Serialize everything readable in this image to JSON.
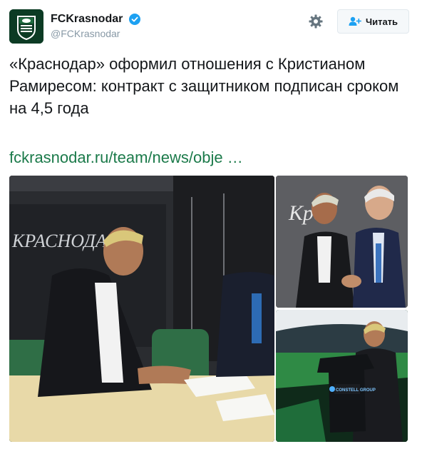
{
  "account": {
    "display_name": "FCKrasnodar",
    "handle": "@FCKrasnodar",
    "verified": true,
    "avatar_icon": "fc-krasnodar-crest-icon"
  },
  "actions": {
    "settings_icon": "gear-icon",
    "follow_label": "Читать",
    "follow_icon": "add-user-icon"
  },
  "tweet": {
    "text": "«Краснодар» оформил отношения с Кристианом Рамиресом: контракт с защитником подписан сроком на 4,5 года",
    "link": "fckrasnodar.ru/team/news/obje …"
  },
  "media": {
    "photo_1_wall_text": "КРАСНОДАР",
    "photo_2_wall_text": "Крас",
    "photo_3_shirt_sponsor": "CONSTELL GROUP"
  },
  "colors": {
    "brand_green": "#0c3b24",
    "link_color": "#1b7a4a",
    "verified_blue": "#1da1f2",
    "handle_gray": "#8899a6"
  }
}
